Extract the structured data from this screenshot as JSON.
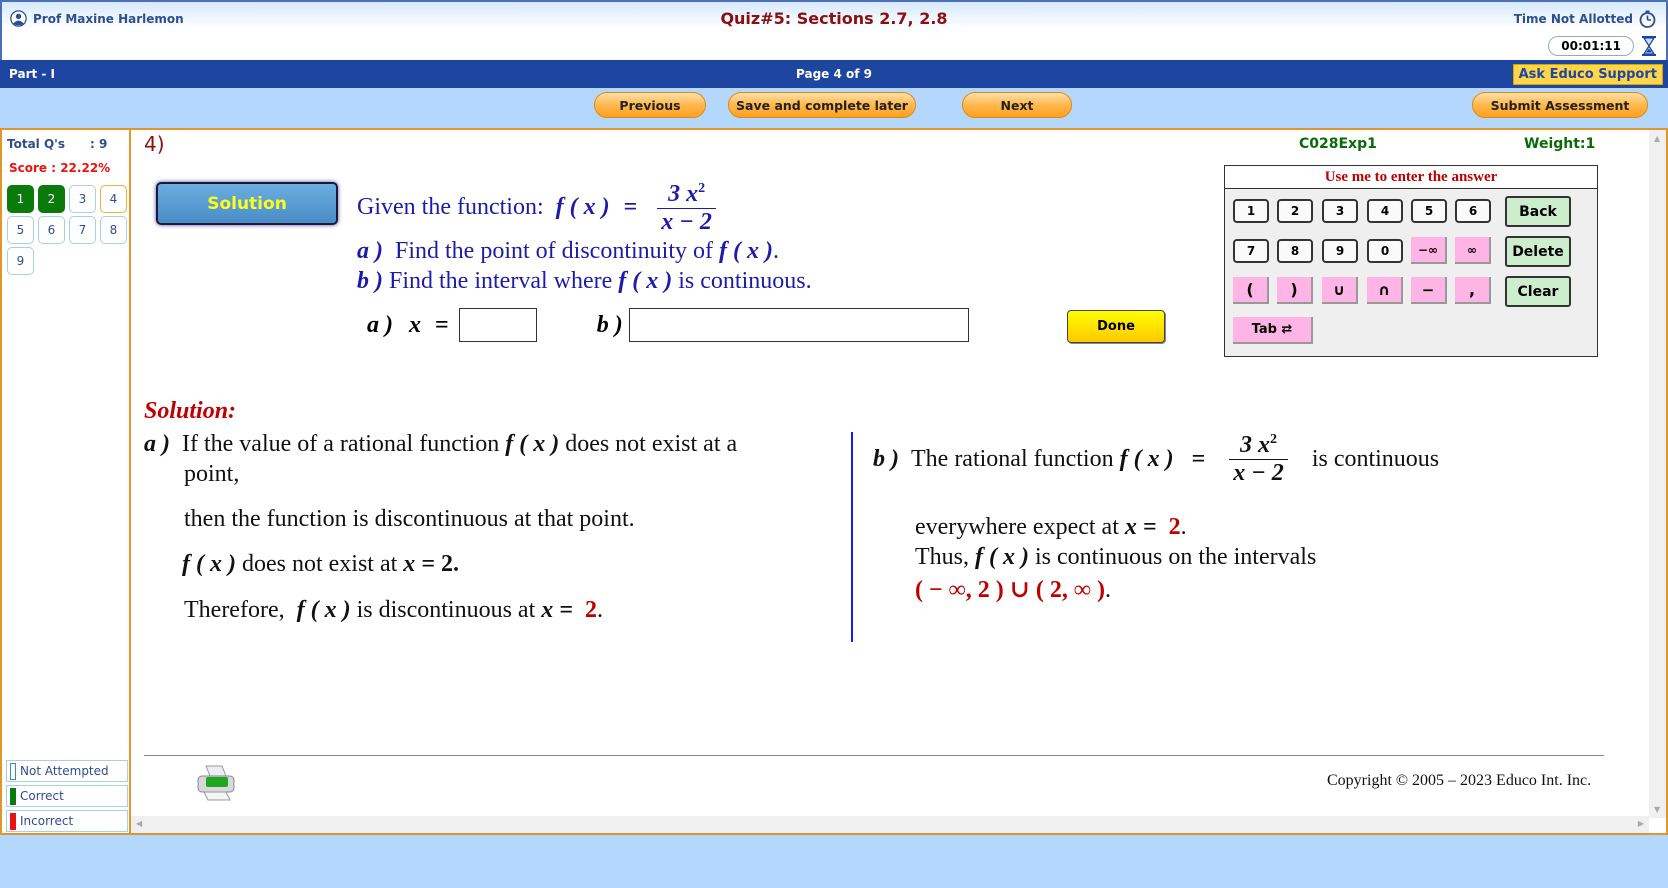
{
  "header": {
    "user_name": "Prof Maxine Harlemon",
    "quiz_title": "Quiz#5: Sections 2.7, 2.8",
    "time_label": "Time Not Allotted",
    "timer": "00:01:11"
  },
  "partbar": {
    "part": "Part - I",
    "page": "Page 4 of 9",
    "support": "Ask Educo Support"
  },
  "nav": {
    "previous": "Previous",
    "save_later": "Save and complete later",
    "next": "Next",
    "submit": "Submit Assessment"
  },
  "sidebar": {
    "total_label": "Total Q's",
    "total_value": ": 9",
    "score": "Score : 22.22%",
    "questions": [
      {
        "n": "1",
        "status": "correct"
      },
      {
        "n": "2",
        "status": "correct"
      },
      {
        "n": "3",
        "status": "not-attempted"
      },
      {
        "n": "4",
        "status": "current"
      },
      {
        "n": "5",
        "status": "not-attempted"
      },
      {
        "n": "6",
        "status": "not-attempted"
      },
      {
        "n": "7",
        "status": "not-attempted"
      },
      {
        "n": "8",
        "status": "not-attempted"
      },
      {
        "n": "9",
        "status": "not-attempted"
      }
    ],
    "legend": [
      {
        "label": "Not Attempted",
        "color": "#ffffff"
      },
      {
        "label": "Correct",
        "color": "#0a7a0a"
      },
      {
        "label": "Incorrect",
        "color": "#ee1111"
      }
    ]
  },
  "question": {
    "number": "4)",
    "code": "C028Exp1",
    "weight": "Weight:1",
    "solution_button": "Solution",
    "given_prefix": "Given the function:",
    "fx": "f ( x )",
    "equals": "=",
    "numerator": "3 x",
    "exponent": "2",
    "denominator": "x − 2",
    "part_a_label": "a )",
    "part_a_text": "Find the point of discontinuity of",
    "part_a_suffix": ".",
    "part_b_label": "b )",
    "part_b_text": "Find the interval where",
    "part_b_suffix": "is continuous.",
    "answer_a_label": "a )",
    "answer_a_var": "x",
    "answer_a_value": "",
    "answer_b_label": "b )",
    "answer_b_value": "",
    "done": "Done"
  },
  "keypad": {
    "title": "Use me to enter the answer",
    "row1": [
      "1",
      "2",
      "3",
      "4",
      "5",
      "6"
    ],
    "row2": [
      "7",
      "8",
      "9",
      "0"
    ],
    "row2_pink": [
      "−∞",
      "∞"
    ],
    "row3_pink": [
      "(",
      ")",
      "∪",
      "∩",
      "−",
      ","
    ],
    "back": "Back",
    "delete": "Delete",
    "clear": "Clear",
    "tab": "Tab ⇄"
  },
  "solution": {
    "title": "Solution:",
    "a_label": "a )",
    "a_line1": "If the value of a rational function",
    "a_line1_end": "does not exist at a",
    "a_line2": "point,",
    "a_line3": "then the function is discontinuous at that point.",
    "a_line4_end": "does not exist at",
    "a_line4_val": "2.",
    "a_line5_start": "Therefore,",
    "a_line5_mid": "is discontinuous at",
    "a_line5_val": "2",
    "b_label": "b )",
    "b_line1": "The rational function",
    "b_line1_end": "is continuous",
    "b_line2": "everywhere expect at",
    "b_line2_val": "2",
    "b_line3_start": "Thus,",
    "b_line3_end": "is continuous on the intervals",
    "b_interval": "( − ∞, 2 )  ∪   ( 2, ∞ )",
    "fx": "f ( x )",
    "xeq": "x  =",
    "period": "."
  },
  "footer": {
    "copyright": "Copyright © 2005 – 2023 Educo Int. Inc."
  }
}
